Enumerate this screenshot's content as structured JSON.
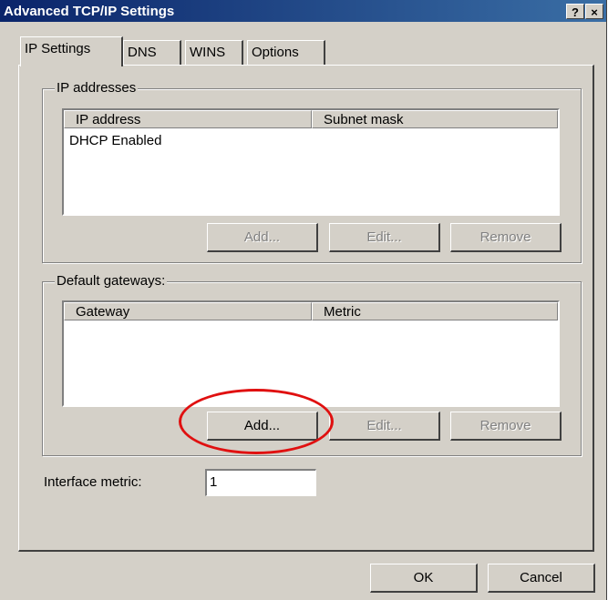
{
  "window": {
    "title": "Advanced TCP/IP Settings",
    "help_label": "?",
    "close_label": "×"
  },
  "tabs": [
    {
      "label": "IP Settings"
    },
    {
      "label": "DNS"
    },
    {
      "label": "WINS"
    },
    {
      "label": "Options"
    }
  ],
  "ip_addresses": {
    "legend": "IP addresses",
    "columns": [
      "IP address",
      "Subnet mask"
    ],
    "rows": [
      "DHCP Enabled"
    ],
    "buttons": {
      "add": "Add...",
      "edit": "Edit...",
      "remove": "Remove"
    }
  },
  "gateways": {
    "legend": "Default gateways:",
    "columns": [
      "Gateway",
      "Metric"
    ],
    "buttons": {
      "add": "Add...",
      "edit": "Edit...",
      "remove": "Remove"
    }
  },
  "interface_metric": {
    "label": "Interface metric:",
    "value": "1"
  },
  "footer": {
    "ok": "OK",
    "cancel": "Cancel"
  },
  "colors": {
    "highlight_ellipse": "#e01010",
    "title_bar": "#0a246a"
  }
}
